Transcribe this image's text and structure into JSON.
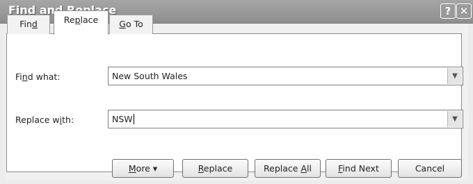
{
  "window": {
    "title": "Find and Replace",
    "help_button": "?",
    "close_button": "✕"
  },
  "tabs": [
    {
      "label": "Find",
      "pre": "Fin",
      "key": "d",
      "post": "",
      "selected": false
    },
    {
      "label": "Replace",
      "pre": "Re",
      "key": "p",
      "post": "lace",
      "selected": true
    },
    {
      "label": "Go To",
      "pre": "",
      "key": "G",
      "post": "o To",
      "selected": false
    }
  ],
  "find": {
    "label": "Find what:",
    "label_pre": "Fi",
    "label_key": "n",
    "label_post": "d what:",
    "value": "New South Wales",
    "dropdown_icon": "chevron-down-icon"
  },
  "replace": {
    "label": "Replace with:",
    "label_pre": "Replace w",
    "label_key": "i",
    "label_post": "th:",
    "value": "NSW",
    "dropdown_icon": "chevron-down-icon"
  },
  "buttons": {
    "more": {
      "label": "More ▾",
      "pre": "",
      "key": "M",
      "post": "ore ▾"
    },
    "replace": {
      "label": "Replace",
      "pre": "",
      "key": "R",
      "post": "eplace"
    },
    "replace_all": {
      "label": "Replace All",
      "pre": "Replace ",
      "key": "A",
      "post": "ll"
    },
    "find_next": {
      "label": "Find Next",
      "pre": "",
      "key": "F",
      "post": "ind Next"
    },
    "cancel": {
      "label": "Cancel"
    }
  },
  "colors": {
    "titlebar": "#9a9a9a",
    "dialog_background": "#f0f0f0",
    "panel_background": "#ffffff"
  }
}
